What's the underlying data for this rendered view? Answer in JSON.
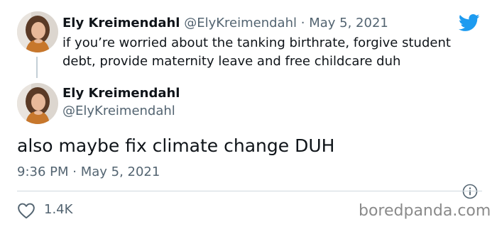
{
  "reply_tweet": {
    "display_name": "Ely Kreimendahl",
    "handle": "@ElyKreimendahl",
    "separator": "·",
    "date": "May 5, 2021",
    "text": "if you’re worried about the tanking birthrate, forgive student debt, provide maternity leave and free childcare duh"
  },
  "main_tweet": {
    "display_name": "Ely Kreimendahl",
    "handle": "@ElyKreimendahl",
    "text": "also maybe fix climate change DUH",
    "timestamp": "9:36 PM · May 5, 2021",
    "like_count": "1.4K"
  },
  "icons": {
    "twitter_logo": "twitter-bird-icon",
    "info": "info-icon",
    "like": "heart-icon"
  },
  "watermark": "boredpanda.com",
  "colors": {
    "twitter_blue": "#1d9bf0",
    "text_primary": "#0f1419",
    "text_secondary": "#536471",
    "divider": "#cfd9de"
  }
}
